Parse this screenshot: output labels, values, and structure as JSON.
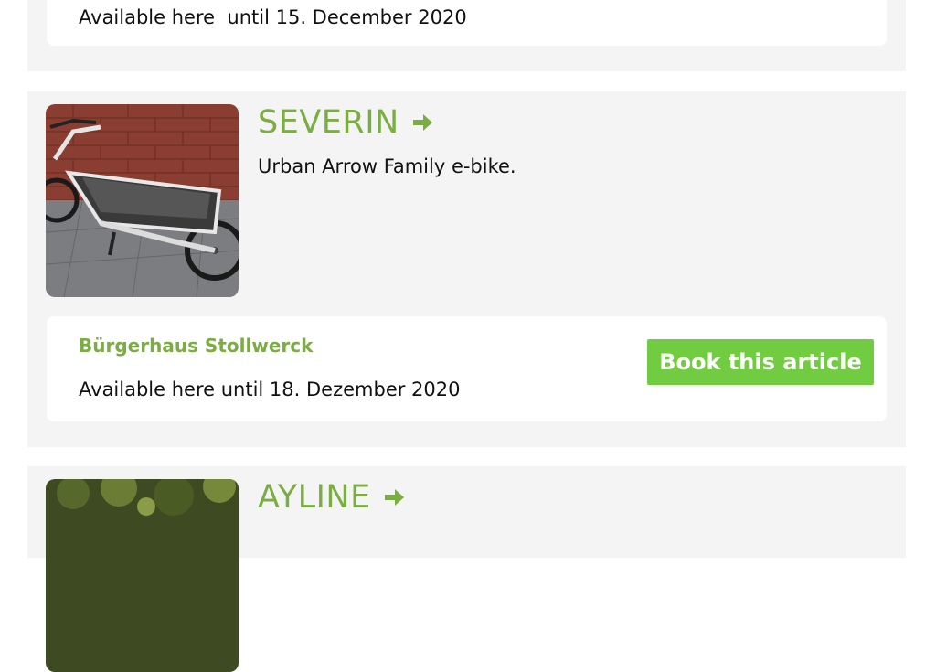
{
  "items": [
    {
      "location": "",
      "availability": "Available here  until 15. December 2020",
      "book_label": ""
    },
    {
      "title": "SEVERIN",
      "description": "Urban Arrow Family e-bike.",
      "location": "Bürgerhaus Stollwerck",
      "availability": "Available here until 18. Dezember 2020",
      "book_label": "Book this article"
    },
    {
      "title": "AYLINE"
    }
  ],
  "colors": {
    "accent_green": "#7cad44",
    "button_green": "#72cc42",
    "card_bg": "#f4f4f4"
  },
  "icons": {
    "title_arrow": "arrow-right-icon"
  }
}
